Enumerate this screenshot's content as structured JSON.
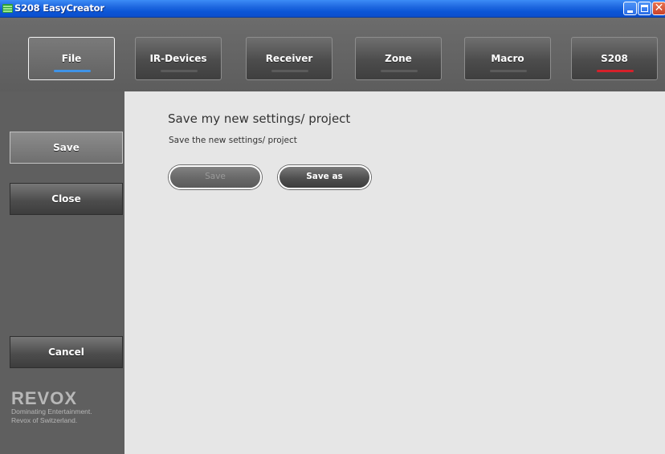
{
  "window": {
    "title": "S208 EasyCreator",
    "controls": [
      "minimize-icon",
      "maximize-icon",
      "close-icon"
    ],
    "close_glyph": "✕"
  },
  "tabs": [
    {
      "label": "File",
      "active": true,
      "indicator": "#3f93e8"
    },
    {
      "label": "IR-Devices",
      "active": false
    },
    {
      "label": "Receiver",
      "active": false
    },
    {
      "label": "Zone",
      "active": false
    },
    {
      "label": "Macro",
      "active": false
    },
    {
      "label": "S208",
      "active": false,
      "indicator": "#d6202a"
    }
  ],
  "sidebar": {
    "items": [
      {
        "label": "Save",
        "selected": true
      },
      {
        "label": "Close",
        "selected": false
      },
      {
        "label": "Cancel",
        "selected": false
      }
    ],
    "logo": {
      "brand": "REVOX",
      "tagline_1": "Dominating Entertainment.",
      "tagline_2": "Revox of Switzerland."
    }
  },
  "main": {
    "title": "Save my new settings/ project",
    "subtitle": "Save the new settings/ project",
    "buttons": {
      "save_label": "Save",
      "save_enabled": false,
      "save_as_label": "Save as"
    }
  },
  "colors": {
    "titlebar": "#0b55d6",
    "content_bg": "#e6e6e6",
    "chrome_bg": "#5f5f5f",
    "accent_blue": "#3f93e8",
    "accent_red": "#d6202a"
  }
}
